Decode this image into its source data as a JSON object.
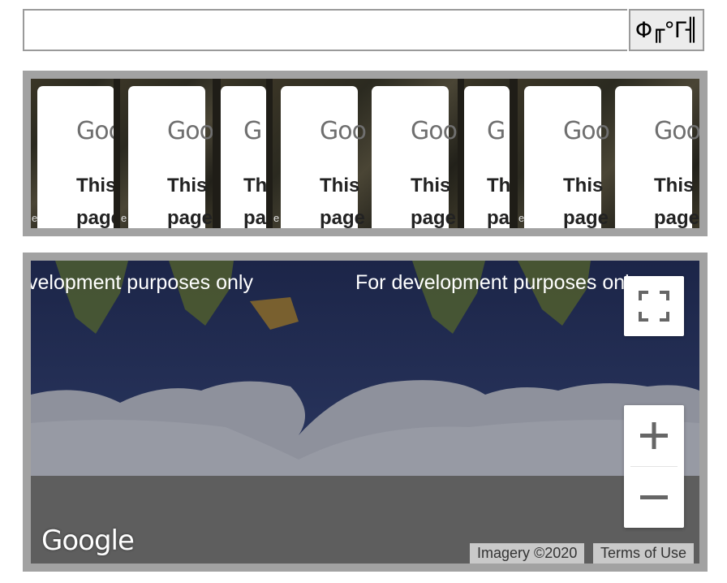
{
  "search": {
    "value": "",
    "placeholder": ""
  },
  "go_button": {
    "label": "Φ╓°Γ╢"
  },
  "thumbnails": {
    "logo_text": "Goo",
    "card_text": "This\npage",
    "bg_logo_text": "G",
    "bg_letter": "e"
  },
  "map": {
    "watermark_text": "For development purposes only",
    "watermark_partial": "velopment purposes only",
    "google_logo": "Google",
    "imagery": "Imagery ©2020",
    "terms": "Terms of Use",
    "controls": {
      "fullscreen_icon": "fullscreen-icon",
      "zoom_in_icon": "plus-icon",
      "zoom_out_icon": "minus-icon"
    },
    "colors": {
      "ocean": "#23305a",
      "ice": "#8c8f9a",
      "land": "#49562f",
      "overlay": "#5e5e5e"
    }
  }
}
